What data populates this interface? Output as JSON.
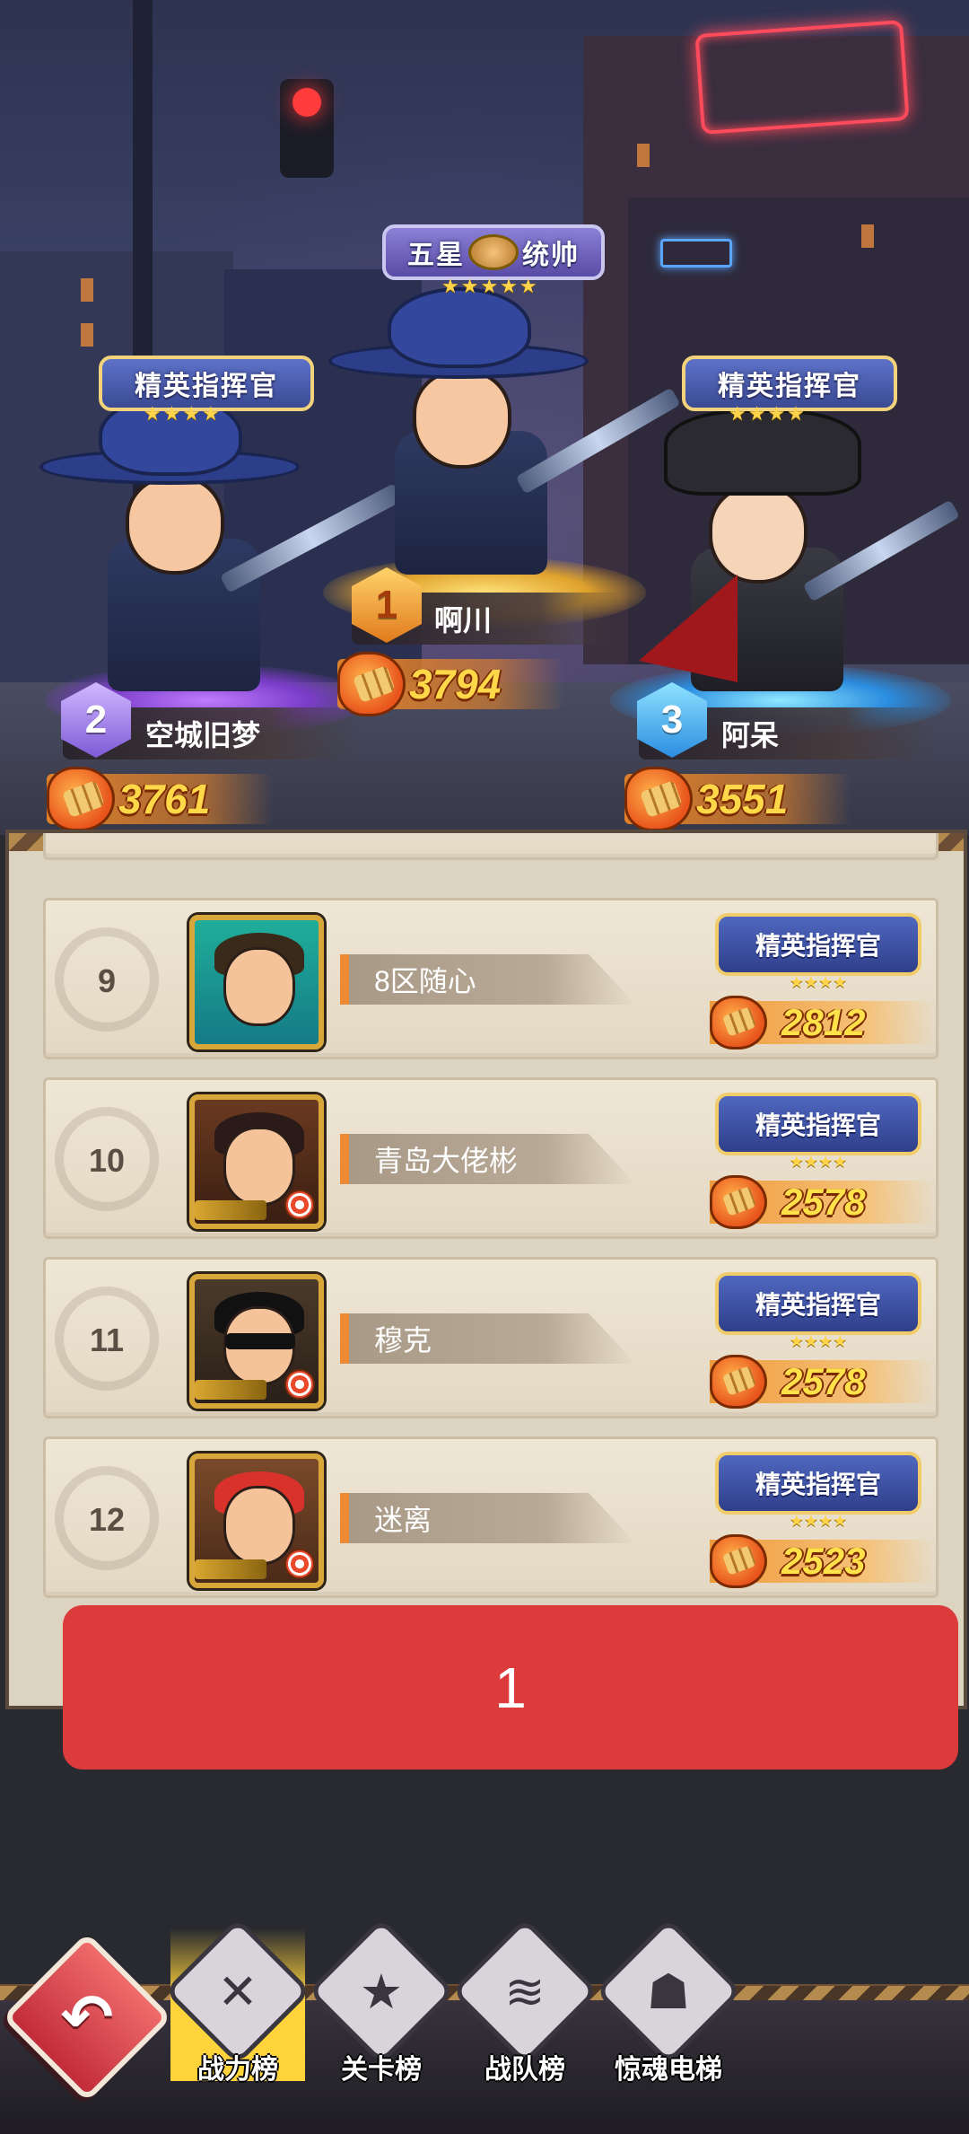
{
  "podium": {
    "first": {
      "rank": "1",
      "name": "啊川",
      "power": "3794",
      "title": "五星统帅",
      "title_parts": [
        "五星",
        "统帅"
      ]
    },
    "second": {
      "rank": "2",
      "name": "空城旧梦",
      "power": "3761",
      "title": "精英指挥官"
    },
    "third": {
      "rank": "3",
      "name": "阿呆",
      "power": "3551",
      "title": "精英指挥官"
    },
    "stars": "★★★★★"
  },
  "list": {
    "rows": [
      {
        "rank": "9",
        "name": "8区随心",
        "title": "精英指挥官",
        "power": "2812"
      },
      {
        "rank": "10",
        "name": "青岛大佬彬",
        "title": "精英指挥官",
        "power": "2578"
      },
      {
        "rank": "11",
        "name": "穆克",
        "title": "精英指挥官",
        "power": "2578"
      },
      {
        "rank": "12",
        "name": "迷离",
        "title": "精英指挥官",
        "power": "2523"
      }
    ],
    "stars": "★★★★"
  },
  "overlay": {
    "label": "1"
  },
  "nav": {
    "back_icon": "back-arrow-icon",
    "tabs": [
      {
        "label": "战力榜",
        "icon": "crossed-bullets-icon",
        "active": true
      },
      {
        "label": "关卡榜",
        "icon": "medal-star-icon",
        "active": false
      },
      {
        "label": "战队榜",
        "icon": "team-shield-icon",
        "active": false
      },
      {
        "label": "惊魂电梯",
        "icon": "ghost-elevator-icon",
        "active": false
      }
    ]
  },
  "colors": {
    "overlay_red": "#db3b3b",
    "power_yellow": "#ffd84a",
    "active_tab": "#ffd43a",
    "panel_bg": "#ddd3c1"
  }
}
